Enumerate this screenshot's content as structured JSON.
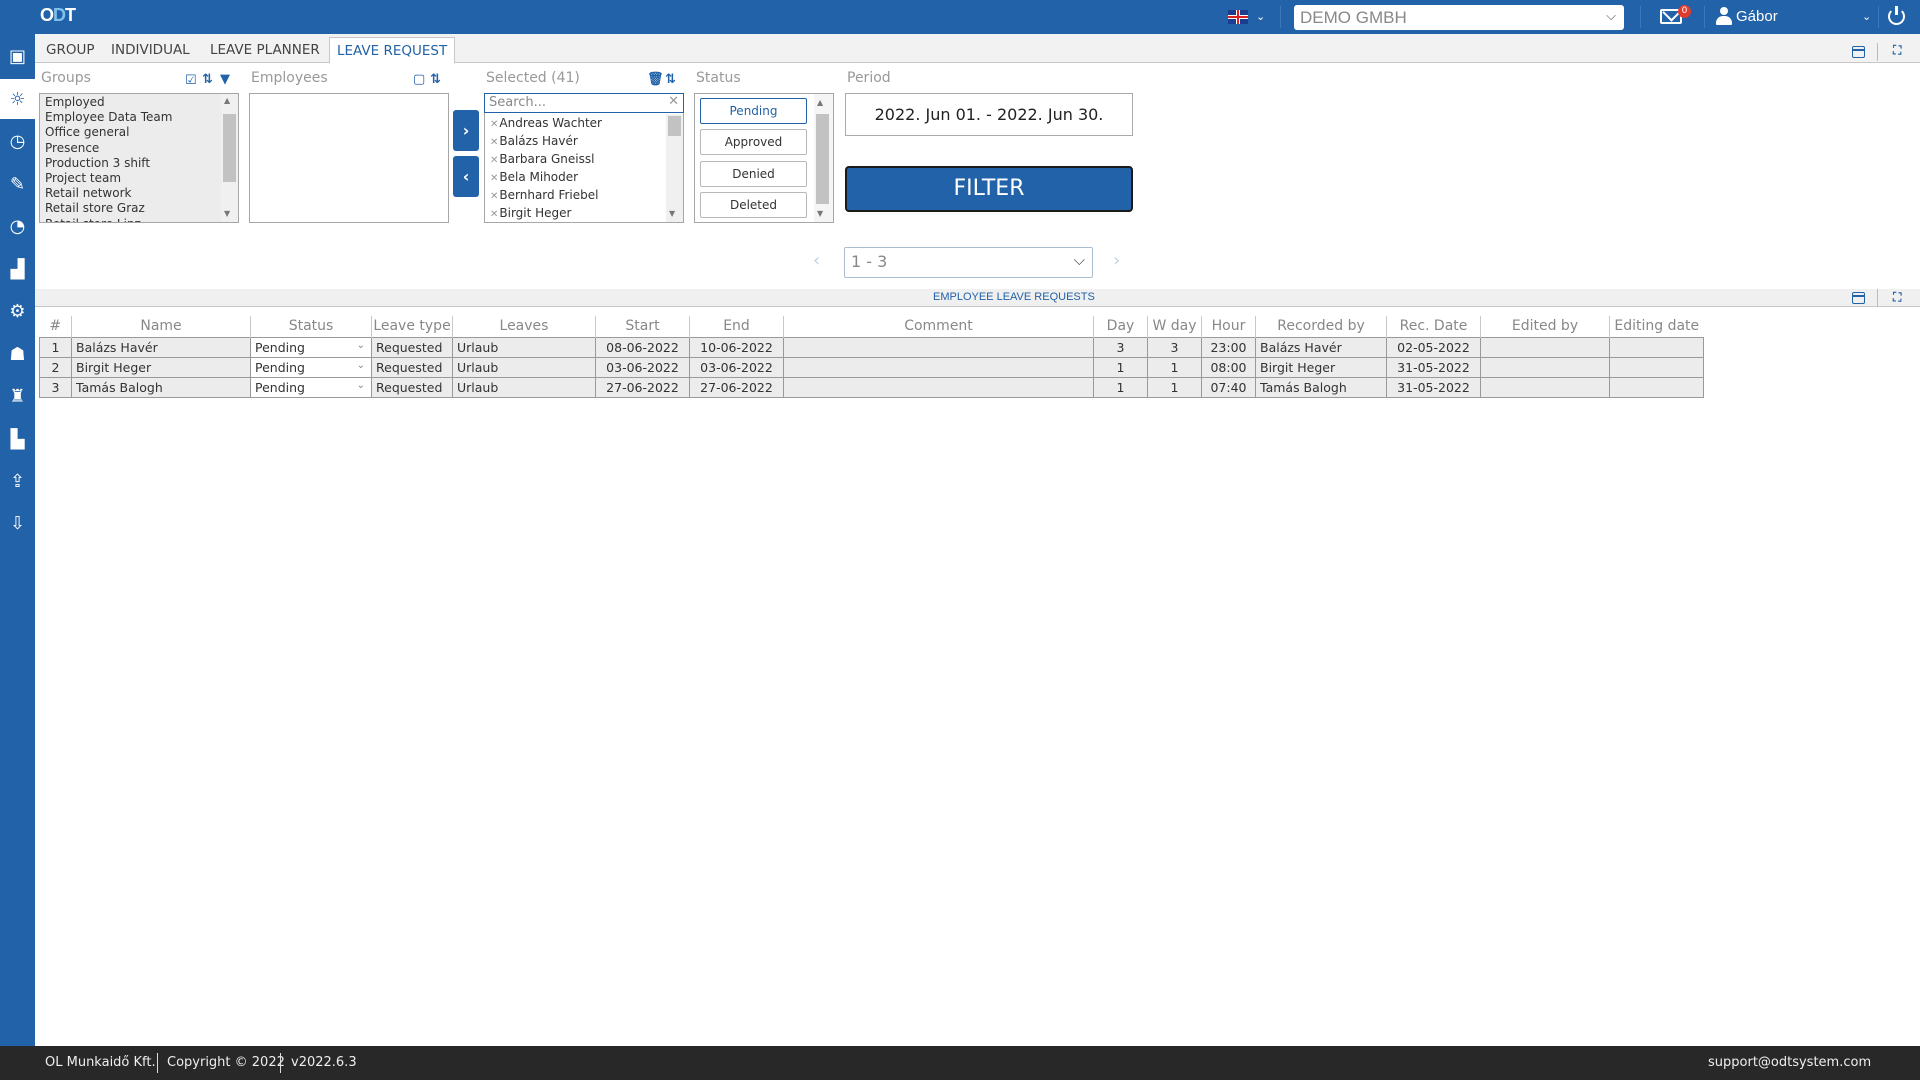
{
  "header": {
    "logo": {
      "o": "O",
      "d": "D",
      "t": "T"
    },
    "language": "en-GB",
    "company": "DEMO GMBH",
    "mail_count": "0",
    "user": "Gábor"
  },
  "sidebar": {
    "items": [
      {
        "icon": "save-icon",
        "glyph": "▣"
      },
      {
        "icon": "sun-icon",
        "glyph": "☼",
        "active": true
      },
      {
        "icon": "clock-icon",
        "glyph": "◷"
      },
      {
        "icon": "tools-icon",
        "glyph": "✎"
      },
      {
        "icon": "satellite-icon",
        "glyph": "◔"
      },
      {
        "icon": "chart-icon",
        "glyph": "▟"
      },
      {
        "icon": "settings-icon",
        "glyph": "⚙"
      },
      {
        "icon": "users-icon",
        "glyph": "☗"
      },
      {
        "icon": "graduate-icon",
        "glyph": "♜"
      },
      {
        "icon": "factory-icon",
        "glyph": "▙"
      },
      {
        "icon": "upload-tray-icon",
        "glyph": "⇪"
      },
      {
        "icon": "download-tray-icon",
        "glyph": "⇩"
      }
    ],
    "bottom_glyph": "⌖"
  },
  "tabs": [
    {
      "label": "GROUP"
    },
    {
      "label": "INDIVIDUAL"
    },
    {
      "label": "LEAVE PLANNER"
    },
    {
      "label": "LEAVE REQUEST",
      "active": true
    }
  ],
  "filters": {
    "groups": {
      "label": "Groups",
      "items": [
        "Employed",
        "Employee Data Team",
        "Office general",
        "Presence",
        "Production 3 shift",
        "Project team",
        "Retail network",
        "Retail store Graz",
        "Retail store Linz"
      ]
    },
    "employees": {
      "label": "Employees",
      "items": []
    },
    "selected": {
      "label": "Selected (41)",
      "search_placeholder": "Search...",
      "items": [
        "Andreas Wachter",
        "Balázs Havér",
        "Barbara Gneissl",
        "Bela Mihoder",
        "Bernhard Friebel",
        "Birgit Heger"
      ]
    },
    "status": {
      "label": "Status",
      "options": [
        {
          "label": "Pending",
          "active": true
        },
        {
          "label": "Approved"
        },
        {
          "label": "Denied"
        },
        {
          "label": "Deleted"
        }
      ]
    },
    "period": {
      "label": "Period",
      "value": "2022. Jun 01. - 2022. Jun 30."
    },
    "filter_button": "FILTER"
  },
  "pager": {
    "value": "1 - 3",
    "prev": "‹",
    "next": "›"
  },
  "section": {
    "title": "EMPLOYEE LEAVE REQUESTS"
  },
  "table": {
    "columns": [
      "#",
      "Name",
      "Status",
      "Leave type",
      "Leaves",
      "Start",
      "End",
      "Comment",
      "Day",
      "W day",
      "Hour",
      "Recorded by",
      "Rec. Date",
      "Edited by",
      "Editing date"
    ],
    "rows": [
      [
        "1",
        "Balázs Havér",
        "Pending",
        "Requested",
        "Urlaub",
        "08-06-2022",
        "10-06-2022",
        "",
        "3",
        "3",
        "23:00",
        "Balázs Havér",
        "02-05-2022",
        "",
        ""
      ],
      [
        "2",
        "Birgit Heger",
        "Pending",
        "Requested",
        "Urlaub",
        "03-06-2022",
        "03-06-2022",
        "",
        "1",
        "1",
        "08:00",
        "Birgit Heger",
        "31-05-2022",
        "",
        ""
      ],
      [
        "3",
        "Tamás Balogh",
        "Pending",
        "Requested",
        "Urlaub",
        "27-06-2022",
        "27-06-2022",
        "",
        "1",
        "1",
        "07:40",
        "Tamás Balogh",
        "31-05-2022",
        "",
        ""
      ]
    ]
  },
  "footer": {
    "company": "OL Munkaidő Kft.",
    "copyright": "Copyright © 2022",
    "version": "v2022.6.3",
    "support": "support@odtsystem.com"
  },
  "colors": {
    "brand": "#2262a8",
    "footer": "#282828",
    "badge": "#e03b2f"
  }
}
